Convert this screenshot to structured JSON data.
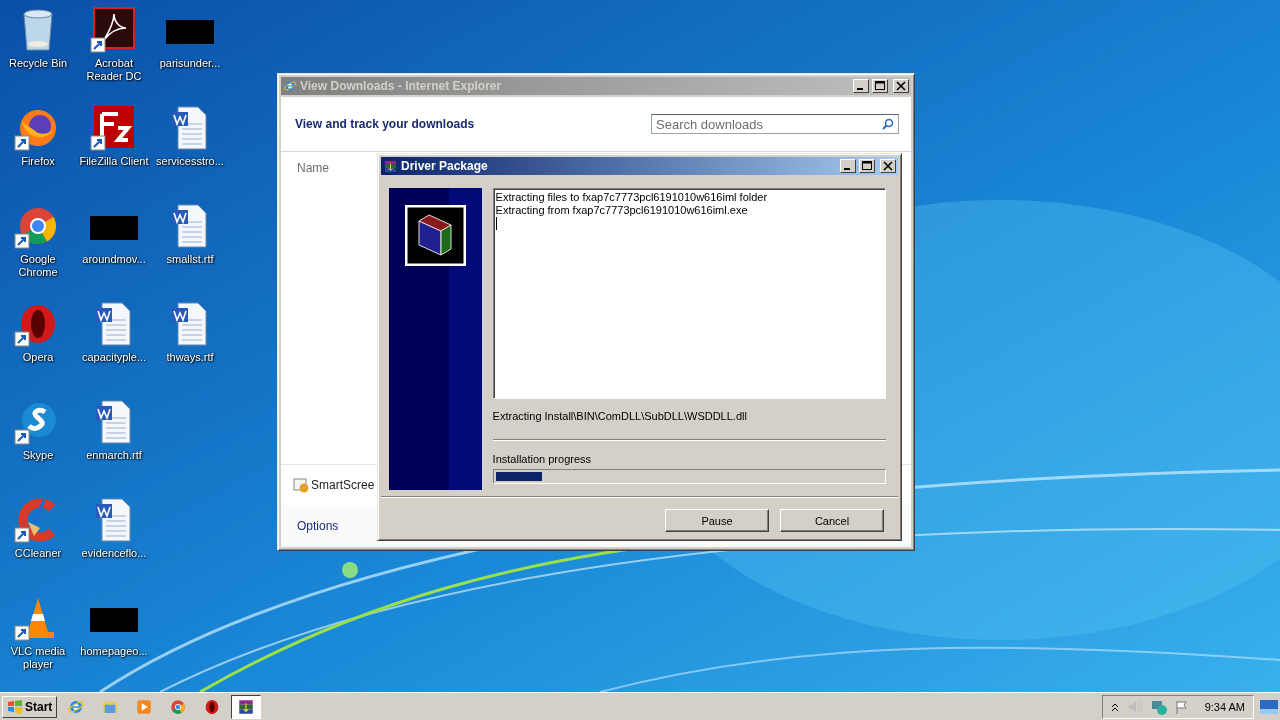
{
  "desktop": {
    "icons": [
      {
        "label": "Recycle Bin",
        "kind": "recycle-bin",
        "shortcut": false
      },
      {
        "label": "Firefox",
        "kind": "firefox",
        "shortcut": true
      },
      {
        "label": "Google Chrome",
        "kind": "chrome",
        "shortcut": true
      },
      {
        "label": "Opera",
        "kind": "opera",
        "shortcut": true
      },
      {
        "label": "Skype",
        "kind": "skype",
        "shortcut": true
      },
      {
        "label": "CCleaner",
        "kind": "ccleaner",
        "shortcut": true
      },
      {
        "label": "VLC media player",
        "kind": "vlc",
        "shortcut": true
      },
      {
        "label": "Acrobat Reader DC",
        "kind": "acrobat",
        "shortcut": true
      },
      {
        "label": "FileZilla Client",
        "kind": "filezilla",
        "shortcut": true
      },
      {
        "label": "aroundmov...",
        "kind": "blacked-out",
        "shortcut": false
      },
      {
        "label": "capacityple...",
        "kind": "word-doc",
        "shortcut": false
      },
      {
        "label": "enmarch.rtf",
        "kind": "word-doc",
        "shortcut": false
      },
      {
        "label": "evidenceflo...",
        "kind": "word-doc",
        "shortcut": false
      },
      {
        "label": "homepageo...",
        "kind": "blacked-out",
        "shortcut": false
      },
      {
        "label": "parisunder...",
        "kind": "blacked-out",
        "shortcut": false
      },
      {
        "label": "servicesstro...",
        "kind": "word-doc",
        "shortcut": false
      },
      {
        "label": "smallst.rtf",
        "kind": "word-doc",
        "shortcut": false
      },
      {
        "label": "thways.rtf",
        "kind": "word-doc",
        "shortcut": false
      }
    ]
  },
  "ie_window": {
    "title": "View Downloads - Internet Explorer",
    "active": false,
    "heading": "View and track your downloads",
    "search": {
      "placeholder": "Search downloads"
    },
    "column_header": "Name",
    "smartscreen": "SmartScree",
    "options_link": "Options"
  },
  "dialog": {
    "title": "Driver Package",
    "active": true,
    "log_lines": [
      "Extracting files to fxap7c7773pcl6191010w616iml folder",
      "Extracting from fxap7c7773pcl6191010w616iml.exe"
    ],
    "status": "Extracting Install\\BIN\\ComDLL\\SubDLL\\WSDDLL.dll",
    "progress_label": "Installation progress",
    "progress": {
      "level": 0.12
    },
    "buttons": [
      "Pause",
      "Cancel"
    ]
  },
  "taskbar": {
    "start": "Start",
    "items": [
      {
        "kind": "ie",
        "selected": false
      },
      {
        "kind": "explorer",
        "selected": false
      },
      {
        "kind": "media-player",
        "selected": false
      },
      {
        "kind": "chrome",
        "selected": false
      },
      {
        "kind": "opera",
        "selected": false
      },
      {
        "kind": "winrar",
        "selected": true
      }
    ],
    "clock": "9:34 AM"
  }
}
